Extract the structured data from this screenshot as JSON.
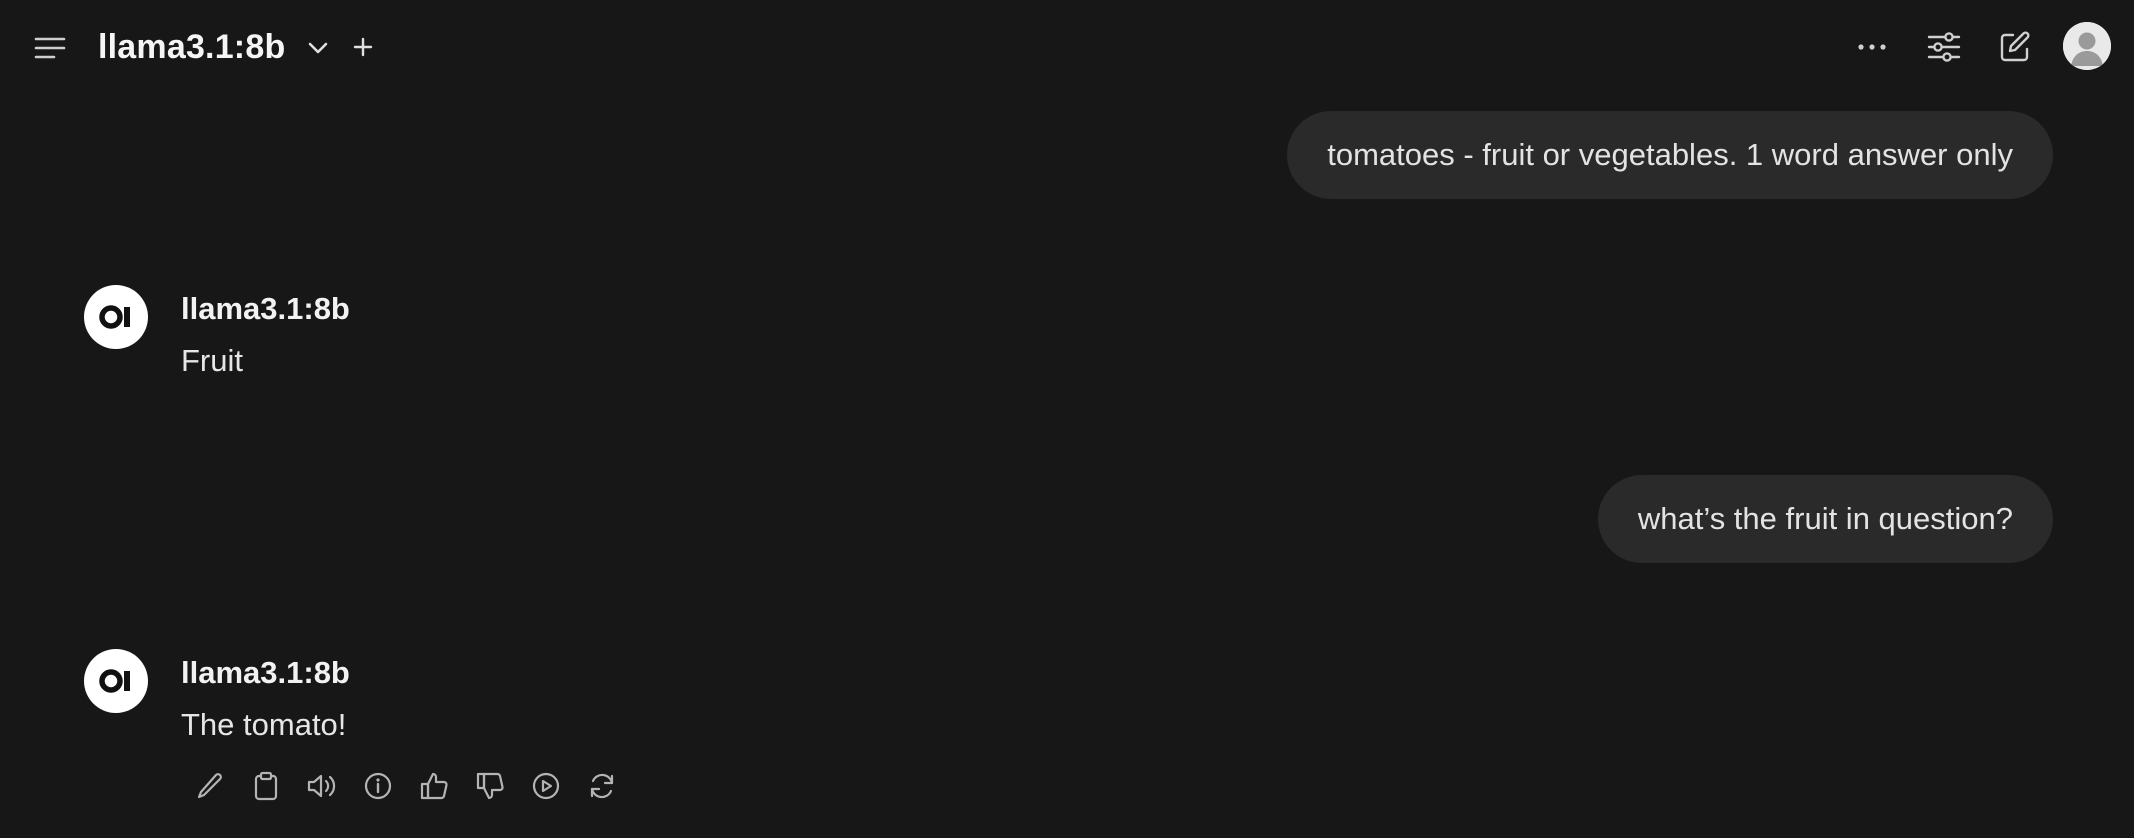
{
  "header": {
    "model_name": "llama3.1:8b"
  },
  "conversation": {
    "messages": [
      {
        "role": "user",
        "text": "tomatoes - fruit or vegetables. 1 word answer only"
      },
      {
        "role": "assistant",
        "model": "llama3.1:8b",
        "text": "Fruit"
      },
      {
        "role": "user",
        "text": "what’s the fruit in question?"
      },
      {
        "role": "assistant",
        "model": "llama3.1:8b",
        "text": "The tomato!"
      }
    ]
  },
  "icons": {
    "header_left": [
      "menu-icon",
      "chevron-down-icon",
      "plus-icon"
    ],
    "header_right": [
      "more-horizontal-icon",
      "sliders-icon",
      "edit-icon",
      "user-avatar"
    ],
    "message_actions": [
      "pencil-icon",
      "clipboard-icon",
      "speaker-icon",
      "info-icon",
      "thumbs-up-icon",
      "thumbs-down-icon",
      "play-circle-icon",
      "regenerate-icon"
    ]
  },
  "colors": {
    "background": "#171717",
    "user_bubble": "#2a2a2a",
    "text": "#ececec",
    "icon": "#b4b4b4"
  }
}
